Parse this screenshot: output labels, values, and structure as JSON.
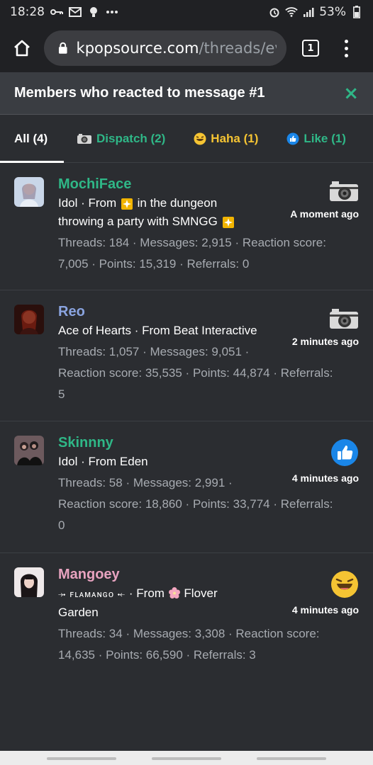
{
  "status_bar": {
    "time": "18:28",
    "battery": "53%",
    "icons_left": [
      "key-icon",
      "mail-icon",
      "bulb-icon",
      "more-dots-icon"
    ],
    "icons_right": [
      "alarm-icon",
      "wifi-icon",
      "signal-icon",
      "battery-icon"
    ]
  },
  "browser": {
    "url_domain": "kpopsource.com",
    "url_path": "/threads/ev",
    "tab_count": "1"
  },
  "overlay": {
    "title": "Members who reacted to message #1",
    "close_label": "×"
  },
  "tabs": [
    {
      "label": "All (4)"
    },
    {
      "label": "Dispatch (2)"
    },
    {
      "label": "Haha (1)"
    },
    {
      "label": "Like (1)"
    }
  ],
  "members": [
    {
      "name": "MochiFace",
      "name_color": "#2fb787",
      "desc_a": "Idol · From",
      "desc_b": "in the dungeon",
      "desc_c": "throwing a party with SMNGG",
      "stats_1": "Threads: 184 · Messages: 2,915 · Reaction score:",
      "stats_2": "7,005 · Points: 15,319 · Referrals: 0",
      "reaction": "camera",
      "time": "A moment ago"
    },
    {
      "name": "Reo",
      "name_color": "#8aa4e0",
      "desc_a": "Ace of Hearts · From Beat Interactive",
      "stats_1": "Threads: 1,057 · Messages: 9,051 ·",
      "stats_2": "Reaction score: 35,535 · Points: 44,874 · Referrals:",
      "stats_3": "5",
      "reaction": "camera",
      "time": "2 minutes ago"
    },
    {
      "name": "Skinnny",
      "name_color": "#2fb787",
      "desc_a": "Idol · From Eden",
      "stats_1": "Threads: 58 · Messages: 2,991 ·",
      "stats_2": "Reaction score: 18,860 · Points: 33,774 · Referrals:",
      "stats_3": "0",
      "reaction": "like",
      "time": "4 minutes ago"
    },
    {
      "name": "Mangoey",
      "name_color": "#e8a3c0",
      "desc_a": "⤞ ꜰʟᴀᴍᴀɴɢᴏ ⤝",
      "desc_b": "· From",
      "desc_c": "Flover",
      "desc_d": "Garden",
      "stats_1": "Threads: 34 · Messages: 3,308 · Reaction score:",
      "stats_2": "14,635 · Points: 66,590 · Referrals: 3",
      "reaction": "haha",
      "time": "4 minutes ago"
    }
  ]
}
